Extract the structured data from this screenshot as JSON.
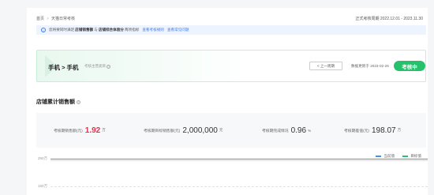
{
  "breadcrumb": {
    "home": "首页",
    "separator": ">",
    "current": "天猫日常考核"
  },
  "period_text": "正式考核周期 2022.12.01 - 2023.11.30",
  "info": {
    "icon": "info-icon",
    "part1": "您将要同时满足",
    "bold1": "店铺销售额",
    "part2": "与",
    "bold2": "店铺综合体验分",
    "part3": "两项指标",
    "link1": "查看考核规则",
    "link2": "查看常见问题"
  },
  "product": {
    "title": "手机 > 手机",
    "hint": "考核主营类目",
    "prev_button": "< 上一周期",
    "updated": "数据更新于 2023-02-26",
    "status": "考核中"
  },
  "section_title": "店铺累计销售额",
  "metrics": [
    {
      "label": "考核期销售额(元)",
      "value": "1.92",
      "unit": "万"
    },
    {
      "label": "考核期目标销售额(元)",
      "value": "2,000,000",
      "unit": "元"
    },
    {
      "label": "考核期完成情况",
      "value": "0.96",
      "unit": "%"
    },
    {
      "label": "考核期差值(元)",
      "value": "198.07",
      "unit": "万"
    }
  ],
  "legend": [
    {
      "name": "当前值",
      "color": "#4a90e2"
    },
    {
      "name": "目标值",
      "color": "#26c16b"
    }
  ],
  "chart_data": {
    "type": "line",
    "y_ticks": [
      "250万",
      "150万"
    ],
    "series": [
      {
        "name": "当前值",
        "color": "#4a90e2"
      },
      {
        "name": "目标值",
        "color": "#26c16b"
      }
    ]
  },
  "colors": {
    "accent_green": "#26c16b",
    "accent_red": "#e8304a",
    "link_blue": "#3c7cf0"
  }
}
